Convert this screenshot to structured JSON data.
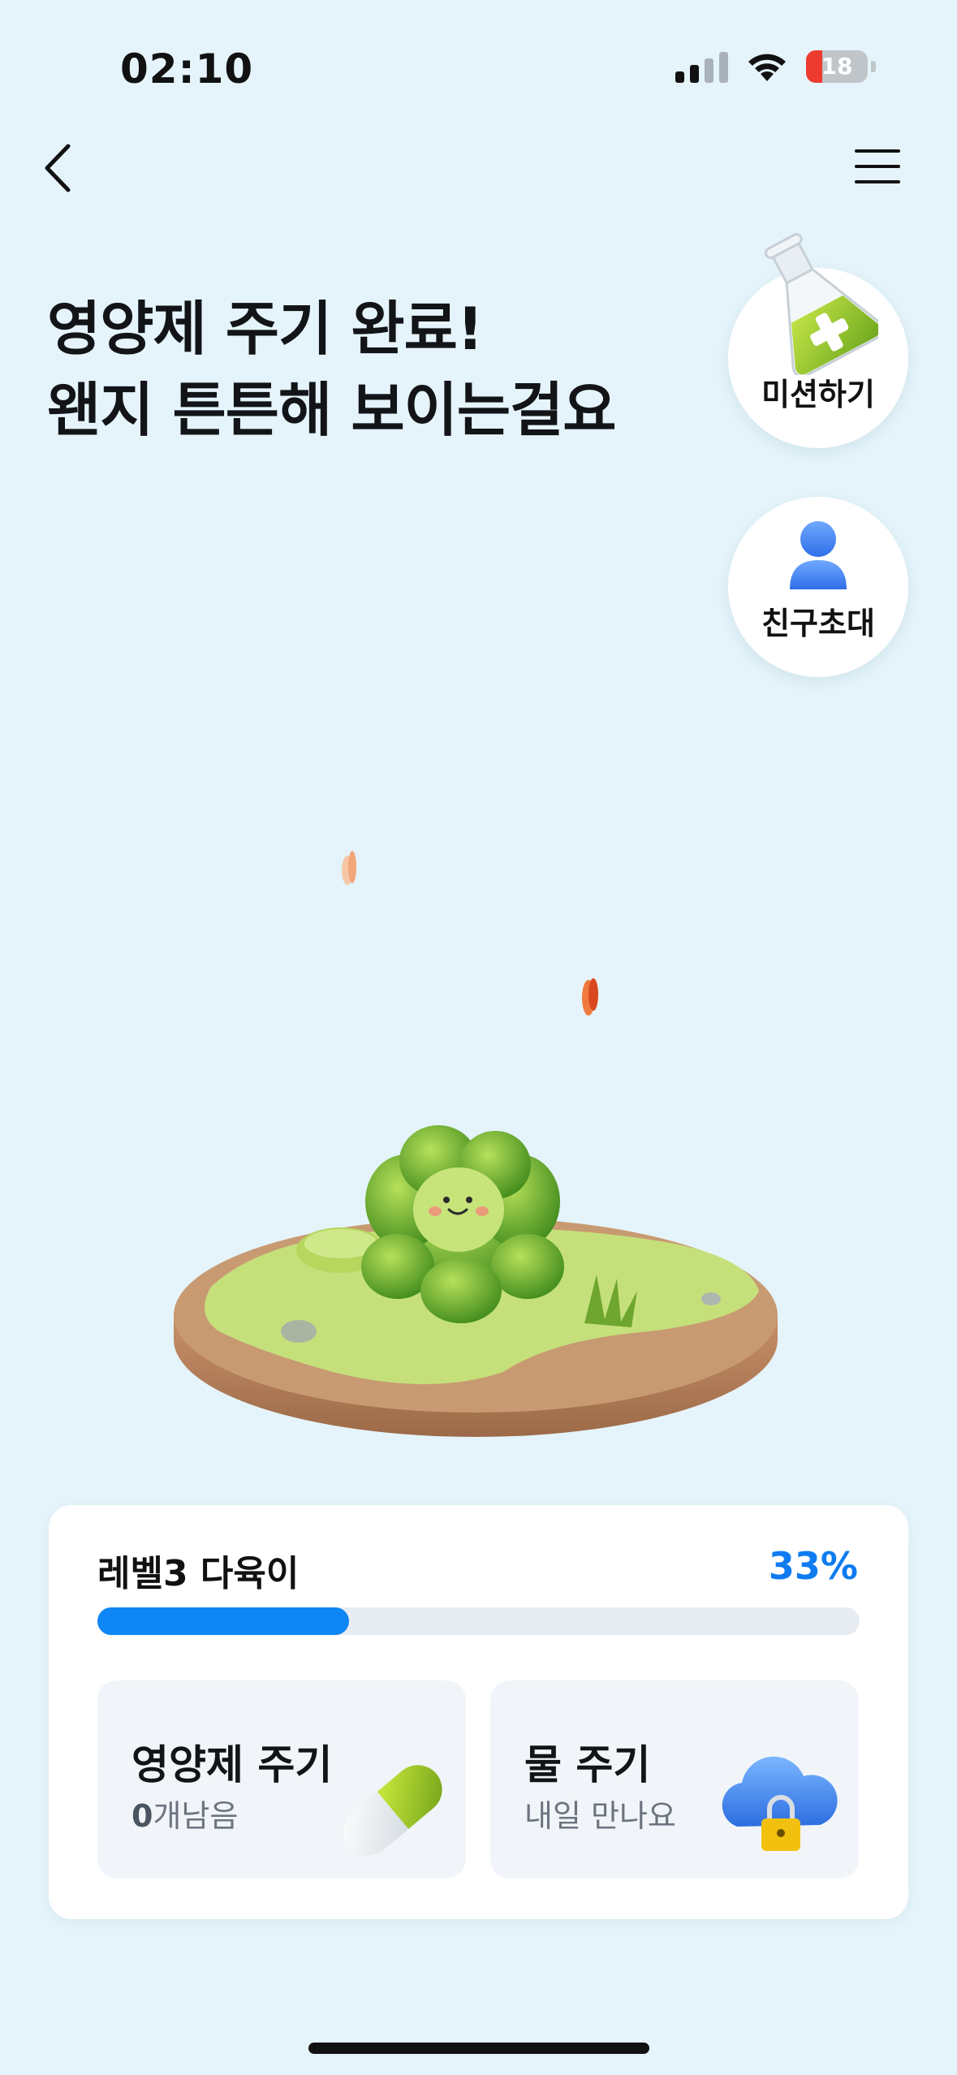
{
  "status_bar": {
    "time": "02:10",
    "battery": "18",
    "icons": [
      "cellular-signal-icon",
      "wifi-icon",
      "battery-icon"
    ]
  },
  "nav": {
    "back_icon": "chevron-left-icon",
    "menu_icon": "hamburger-menu-icon"
  },
  "headline": {
    "line1": "영양제 주기 완료!",
    "line2": "왠지 튼튼해 보이는걸요"
  },
  "side_buttons": {
    "mission": {
      "label": "미션하기",
      "icon": "flask-icon"
    },
    "invite": {
      "label": "친구초대",
      "icon": "person-icon"
    }
  },
  "progress": {
    "level_label": "레벨3 다육이",
    "percent_text": "33%",
    "percent": 33
  },
  "actions": {
    "nutrient": {
      "title": "영양제 주기",
      "count": "0",
      "count_suffix": "개남음",
      "icon": "capsule-icon"
    },
    "water": {
      "title": "물 주기",
      "subtitle": "내일 만나요",
      "icon": "locked-cloud-icon"
    }
  },
  "colors": {
    "background": "#E5F4FA",
    "accent": "#0E86F5",
    "plant": "#7DBE3A"
  }
}
